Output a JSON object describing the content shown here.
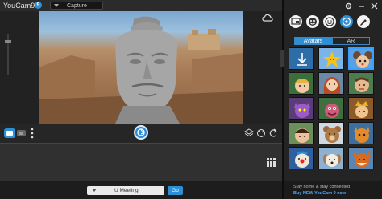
{
  "app": {
    "name": "YouCam9",
    "badge": "9"
  },
  "toolbar": {
    "mode_value": "Capture"
  },
  "bottom": {
    "meeting_value": "U Meeting",
    "go_label": "Go"
  },
  "panel": {
    "tabs": [
      {
        "label": "Avatars",
        "active": true
      },
      {
        "label": "AR",
        "active": false
      }
    ],
    "tools": [
      "screen-icon",
      "face-icon",
      "smiley-icon",
      "effects-icon",
      "brush-icon"
    ],
    "active_tool": "effects-icon",
    "avatars": [
      "download",
      "sunburst-star",
      "cartoon-mouse",
      "blond-boy",
      "red-hair-girl",
      "grumpy-kid",
      "purple-cat",
      "pink-puppet",
      "gold-crown",
      "dark-hair-kid",
      "brown-bear",
      "orange-cat",
      "clown-face",
      "white-puppy",
      "fox-face"
    ],
    "selected_avatar": 2,
    "promo_line1": "Stay home & stay connected",
    "promo_line2": "Buy NEW YouCam 9 now"
  },
  "colors": {
    "accent": "#2d8fd5",
    "background": "#1b1b1b",
    "panel": "#242424"
  }
}
